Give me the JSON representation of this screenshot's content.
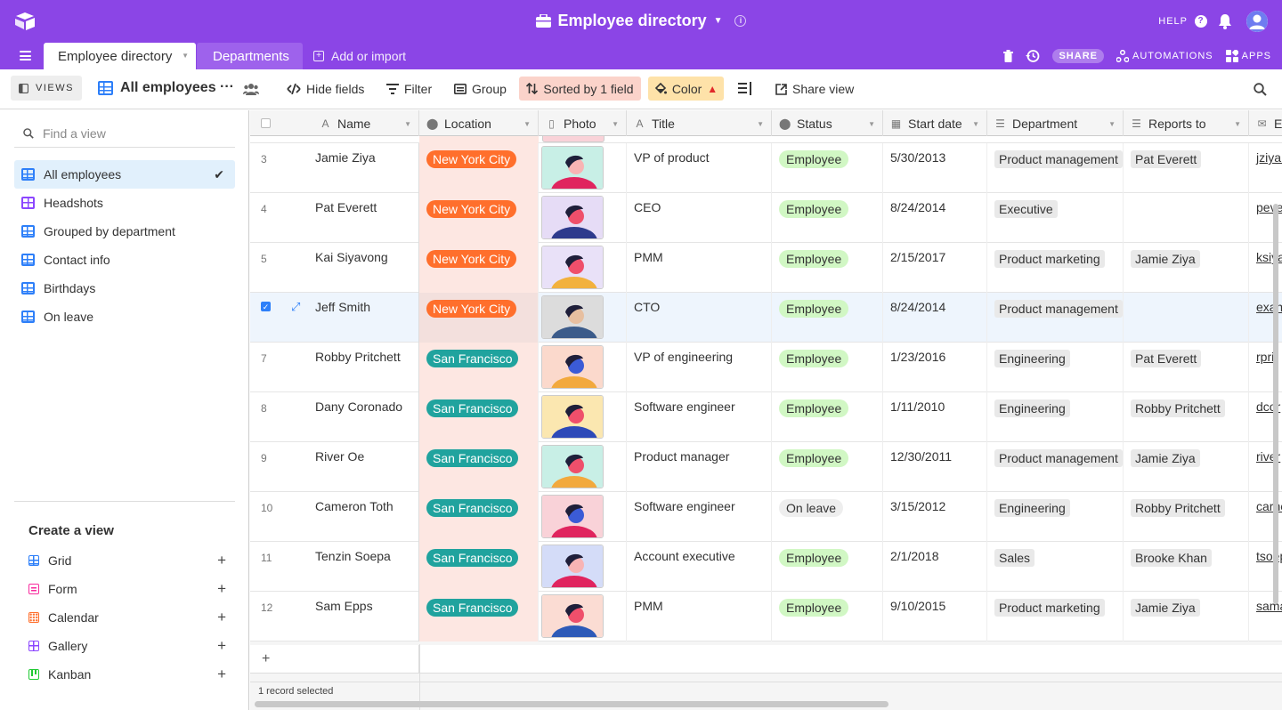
{
  "app": {
    "base_title": "Employee directory",
    "help_label": "HELP"
  },
  "tabs": {
    "active": "Employee directory",
    "second": "Departments",
    "add_import": "Add or import"
  },
  "toolbar_right": {
    "share": "SHARE",
    "automations": "AUTOMATIONS",
    "apps": "APPS"
  },
  "viewbar": {
    "views_button": "VIEWS",
    "view_name": "All employees",
    "hide_fields": "Hide fields",
    "filter": "Filter",
    "group": "Group",
    "sorted": "Sorted by 1 field",
    "color": "Color",
    "share_view": "Share view"
  },
  "sidebar": {
    "find_placeholder": "Find a view",
    "views": [
      {
        "label": "All employees",
        "type": "grid",
        "active": true
      },
      {
        "label": "Headshots",
        "type": "gallery",
        "active": false
      },
      {
        "label": "Grouped by department",
        "type": "grid",
        "active": false
      },
      {
        "label": "Contact info",
        "type": "grid",
        "active": false
      },
      {
        "label": "Birthdays",
        "type": "grid",
        "active": false
      },
      {
        "label": "On leave",
        "type": "grid",
        "active": false
      }
    ],
    "create_title": "Create a view",
    "create_items": [
      {
        "label": "Grid",
        "color": "#2d7ff9"
      },
      {
        "label": "Form",
        "color": "#f82b9e"
      },
      {
        "label": "Calendar",
        "color": "#ff6f2c"
      },
      {
        "label": "Gallery",
        "color": "#8b46ff"
      },
      {
        "label": "Kanban",
        "color": "#20c933"
      }
    ]
  },
  "grid": {
    "columns": [
      "Name",
      "Location",
      "Photo",
      "Title",
      "Status",
      "Start date",
      "Department",
      "Reports to",
      "Em"
    ],
    "rows": [
      {
        "num": "3",
        "name": "Jamie Ziya",
        "location": "New York City",
        "title": "VP of product",
        "status": "Employee",
        "start": "5/30/2013",
        "dept": "Product management",
        "reports": "Pat Everett",
        "email": "jziya@",
        "photo_bg": "#c8efe6",
        "skin": "#f8b4b4",
        "cloth": "#e0245e",
        "selected": false
      },
      {
        "num": "4",
        "name": "Pat Everett",
        "location": "New York City",
        "title": "CEO",
        "status": "Employee",
        "start": "8/24/2014",
        "dept": "Executive",
        "reports": "",
        "email": "peve",
        "photo_bg": "#e6dcf6",
        "skin": "#ef4f6b",
        "cloth": "#2d3a8c",
        "selected": false
      },
      {
        "num": "5",
        "name": "Kai Siyavong",
        "location": "New York City",
        "title": "PMM",
        "status": "Employee",
        "start": "2/15/2017",
        "dept": "Product marketing",
        "reports": "Jamie Ziya",
        "email": "ksiya",
        "photo_bg": "#e9e1f8",
        "skin": "#ef4f6b",
        "cloth": "#f2b13d",
        "selected": false
      },
      {
        "num": "",
        "name": "Jeff Smith",
        "location": "New York City",
        "title": "CTO",
        "status": "Employee",
        "start": "8/24/2014",
        "dept": "Product management",
        "reports": "",
        "email": "exam",
        "photo_bg": "#dcdcdc",
        "skin": "#e7bfa0",
        "cloth": "#3b5b8a",
        "selected": true
      },
      {
        "num": "7",
        "name": "Robby Pritchett",
        "location": "San Francisco",
        "title": "VP of engineering",
        "status": "Employee",
        "start": "1/23/2016",
        "dept": "Engineering",
        "reports": "Pat Everett",
        "email": "rprit",
        "photo_bg": "#fbd9cc",
        "skin": "#3b5bd6",
        "cloth": "#f2a93d",
        "selected": false
      },
      {
        "num": "8",
        "name": "Dany Coronado",
        "location": "San Francisco",
        "title": "Software engineer",
        "status": "Employee",
        "start": "1/11/2010",
        "dept": "Engineering",
        "reports": "Robby Pritchett",
        "email": "dcor",
        "photo_bg": "#fbe7b0",
        "skin": "#ef4f6b",
        "cloth": "#2d4ab8",
        "selected": false
      },
      {
        "num": "9",
        "name": "River Oe",
        "location": "San Francisco",
        "title": "Product manager",
        "status": "Employee",
        "start": "12/30/2011",
        "dept": "Product management",
        "reports": "Jamie Ziya",
        "email": "river",
        "photo_bg": "#c8efe6",
        "skin": "#ef4f6b",
        "cloth": "#f2a93d",
        "selected": false
      },
      {
        "num": "10",
        "name": "Cameron Toth",
        "location": "San Francisco",
        "title": "Software engineer",
        "status": "On leave",
        "start": "3/15/2012",
        "dept": "Engineering",
        "reports": "Robby Pritchett",
        "email": "carne",
        "photo_bg": "#f9d2d8",
        "skin": "#3b5bd6",
        "cloth": "#e0245e",
        "selected": false
      },
      {
        "num": "11",
        "name": "Tenzin Soepa",
        "location": "San Francisco",
        "title": "Account executive",
        "status": "Employee",
        "start": "2/1/2018",
        "dept": "Sales",
        "reports": "Brooke Khan",
        "email": "tsoep",
        "photo_bg": "#d4dcf8",
        "skin": "#f8b4b4",
        "cloth": "#e0245e",
        "selected": false
      },
      {
        "num": "12",
        "name": "Sam Epps",
        "location": "San Francisco",
        "title": "PMM",
        "status": "Employee",
        "start": "9/10/2015",
        "dept": "Product marketing",
        "reports": "Jamie Ziya",
        "email": "sama",
        "photo_bg": "#fbdcd3",
        "skin": "#ef4f6b",
        "cloth": "#2d5ab8",
        "selected": false
      }
    ],
    "footer": "1 record selected"
  },
  "colors": {
    "brand": "#8b45e6",
    "nyc": "#ff6f2c",
    "sf": "#20a39e",
    "employee": "#d1f7c4",
    "on_leave": "#eeeeee"
  }
}
